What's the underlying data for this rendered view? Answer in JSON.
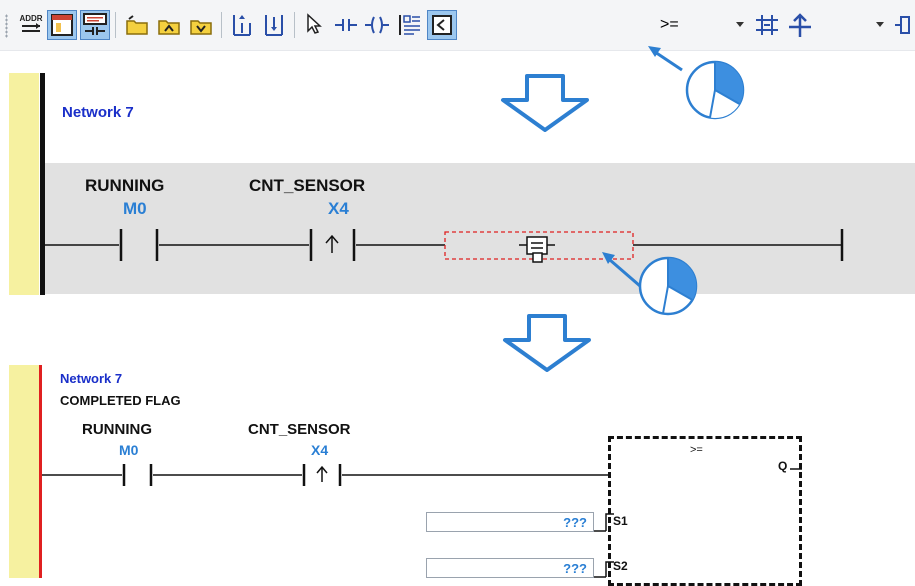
{
  "toolbar": {
    "items": [
      {
        "name": "address-toggle-icon",
        "tip": "ADDR"
      },
      {
        "name": "comment-window-icon"
      },
      {
        "name": "network-comment-icon"
      },
      {
        "name": "open-folder-icon"
      },
      {
        "name": "open-folder-up-icon"
      },
      {
        "name": "open-folder-down-icon"
      },
      {
        "name": "insert-network-above-icon"
      },
      {
        "name": "insert-network-below-icon"
      },
      {
        "name": "select-pointer-icon"
      },
      {
        "name": "contact-icon"
      },
      {
        "name": "coil-icon"
      },
      {
        "name": "instruction-list-icon"
      },
      {
        "name": "function-block-icon"
      },
      {
        "name": "parallel-branch-icon"
      },
      {
        "name": "branch-up-icon"
      },
      {
        "name": "output-bracket-icon"
      }
    ],
    "compare_value": ">=",
    "accent": "#9cc7ee"
  },
  "network1": {
    "title": "Network 7",
    "contacts": [
      {
        "name": "RUNNING",
        "address": "M0"
      },
      {
        "name": "CNT_SENSOR",
        "address": "X4"
      }
    ]
  },
  "network2": {
    "title": "Network 7",
    "comment": "COMPLETED FLAG",
    "contacts": [
      {
        "name": "RUNNING",
        "address": "M0"
      },
      {
        "name": "CNT_SENSOR",
        "address": "X4"
      }
    ],
    "block": {
      "operator": ">=",
      "output_pin": "Q",
      "inputs": [
        {
          "pin": "S1",
          "value": "???"
        },
        {
          "pin": "S2",
          "value": "???"
        }
      ]
    }
  },
  "colors": {
    "rail_yellow": "#f6f1a0",
    "network_title": "#1a2fc9",
    "address_blue": "#2a7fd4",
    "arrow_blue": "#2d7fd1",
    "rail_red": "#e02020"
  }
}
